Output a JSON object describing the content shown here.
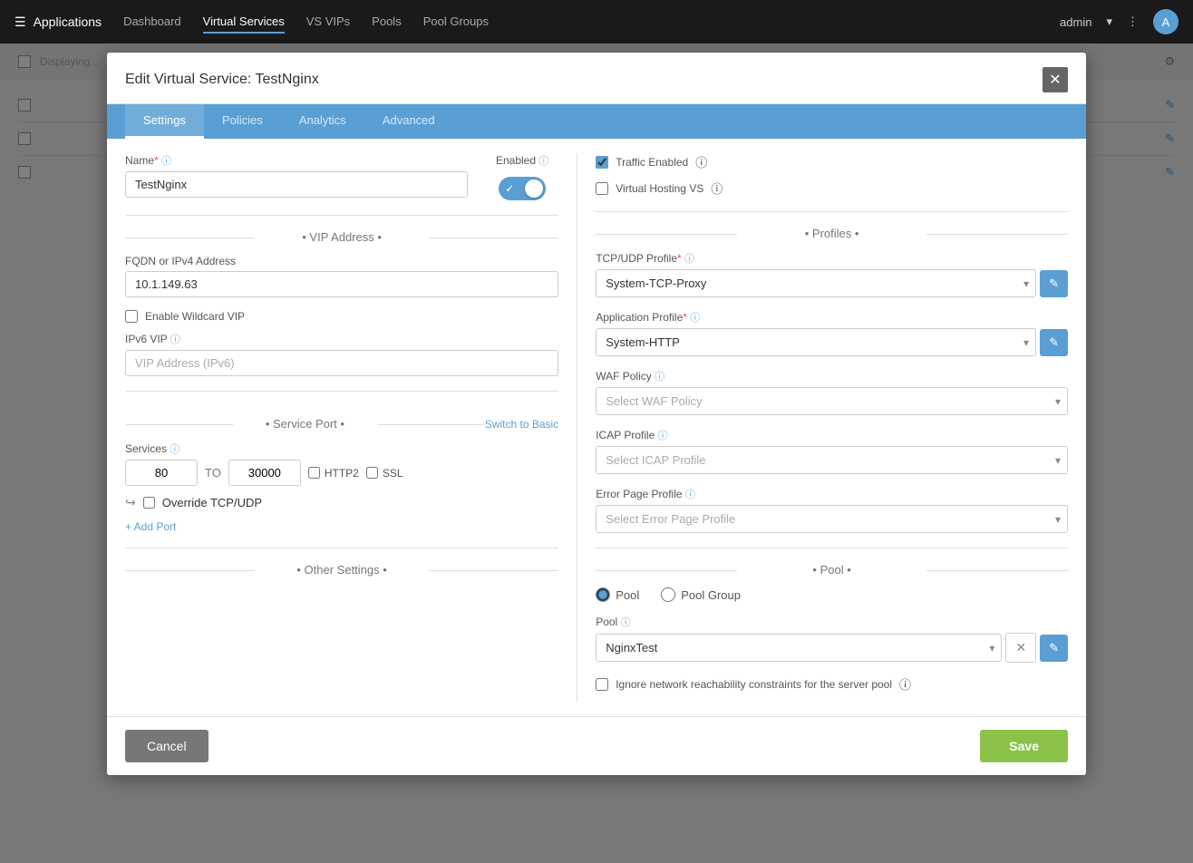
{
  "topNav": {
    "appTitle": "Applications",
    "links": [
      "Dashboard",
      "Virtual Services",
      "VS VIPs",
      "Pools",
      "Pool Groups"
    ],
    "activeLink": "Virtual Services",
    "adminLabel": "admin"
  },
  "modal": {
    "title": "Edit Virtual Service: TestNginx",
    "tabs": [
      "Settings",
      "Policies",
      "Analytics",
      "Advanced"
    ],
    "activeTab": "Settings"
  },
  "form": {
    "nameLabel": "Name",
    "nameValue": "TestNginx",
    "enabledLabel": "Enabled",
    "trafficEnabledLabel": "Traffic Enabled",
    "virtualHostingLabel": "Virtual Hosting VS",
    "vipSection": "• VIP Address •",
    "fqdnLabel": "FQDN or IPv4 Address",
    "fqdnValue": "10.1.149.63",
    "enableWildcardLabel": "Enable Wildcard VIP",
    "ipv6Label": "IPv6 VIP",
    "ipv6Placeholder": "VIP Address (IPv6)",
    "profilesSection": "• Profiles •",
    "tcpProfileLabel": "TCP/UDP Profile",
    "tcpProfileValue": "System-TCP-Proxy",
    "appProfileLabel": "Application Profile",
    "appProfileValue": "System-HTTP",
    "wafPolicyLabel": "WAF Policy",
    "wafPolicyPlaceholder": "Select WAF Policy",
    "icapProfileLabel": "ICAP Profile",
    "icapProfilePlaceholder": "Select ICAP Profile",
    "errorPageLabel": "Error Page Profile",
    "errorPagePlaceholder": "Select Error Page Profile",
    "servicePortSection": "• Service Port •",
    "switchToBasicLabel": "Switch to Basic",
    "servicesLabel": "Services",
    "portFrom": "80",
    "portTo": "30000",
    "http2Label": "HTTP2",
    "sslLabel": "SSL",
    "overrideTcpLabel": "Override TCP/UDP",
    "addPortLabel": "+ Add Port",
    "poolSection": "• Pool •",
    "poolOptionLabel": "Pool",
    "poolGroupOptionLabel": "Pool Group",
    "poolLabel": "Pool",
    "poolValue": "NginxTest",
    "ignoreNetworkLabel": "Ignore network reachability constraints for the server pool",
    "otherSettingsSection": "• Other Settings •",
    "cancelLabel": "Cancel",
    "saveLabel": "Save"
  }
}
